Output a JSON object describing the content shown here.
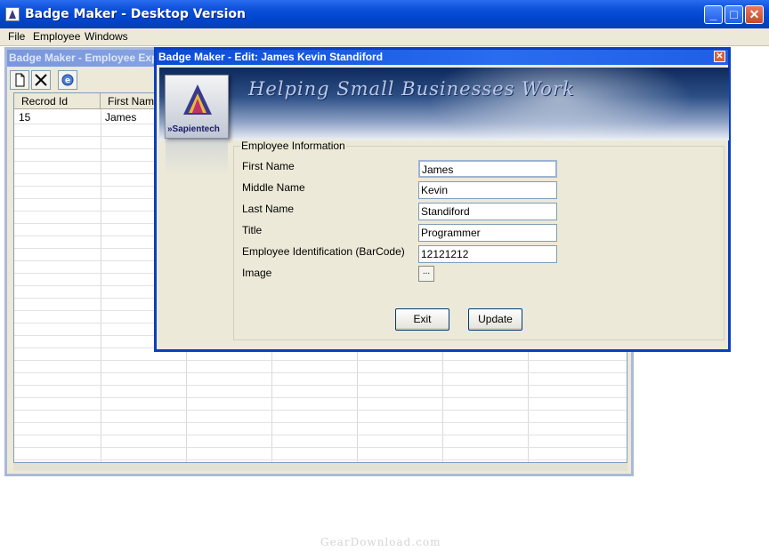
{
  "main_window": {
    "title": "Badge Maker - Desktop Version"
  },
  "menu": [
    "File",
    "Employee",
    "Windows"
  ],
  "explorer": {
    "title": "Badge Maker - Employee Exp",
    "toolbar": {
      "new_icon": "new-document-icon",
      "delete_icon": "delete-x-icon",
      "refresh_icon": "refresh-icon"
    },
    "columns": [
      "Recrod Id",
      "First Name"
    ],
    "rows": [
      {
        "id": "15",
        "first_name": "James"
      }
    ]
  },
  "edit_dialog": {
    "title": "Badge Maker - Edit: James Kevin Standiford",
    "banner_slogan": "Helping Small Businesses Work",
    "logo_text": "»Sapientech",
    "group_label": "Employee Information",
    "fields": {
      "first_name": {
        "label": "First Name",
        "value": "James"
      },
      "middle_name": {
        "label": "Middle Name",
        "value": "Kevin"
      },
      "last_name": {
        "label": "Last Name",
        "value": "Standiford"
      },
      "title": {
        "label": "Title",
        "value": "Programmer"
      },
      "employee_id": {
        "label": "Employee Identification (BarCode)",
        "value": "12121212"
      },
      "image": {
        "label": "Image",
        "button": "..."
      }
    },
    "buttons": {
      "exit": "Exit",
      "update": "Update"
    }
  },
  "watermark": "GearDownload.com",
  "colors": {
    "titlebar": "#0a4fd8",
    "face": "#ece9d8",
    "inactive_title": "#7a96df"
  }
}
